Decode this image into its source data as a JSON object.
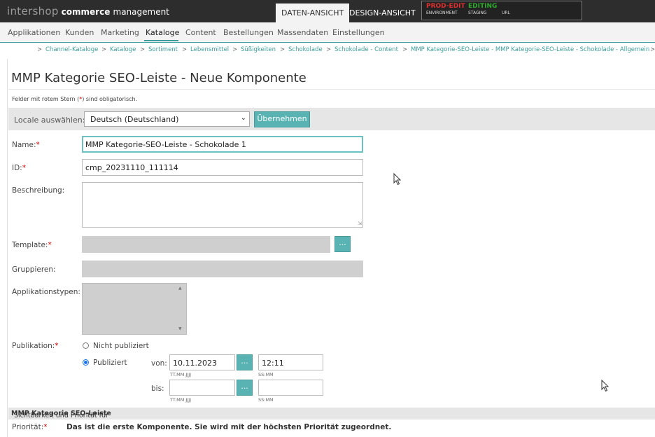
{
  "app": {
    "brand": "intershop",
    "name_bold": "commerce",
    "name_light": "management"
  },
  "view_tabs": {
    "data_view": "DATEN-ANSICHT",
    "design_view": "DESIGN-ANSICHT"
  },
  "environment": {
    "environment_value": "PROD-EDIT",
    "environment_label": "ENVIRONMENT",
    "staging_value": "EDITING",
    "staging_label": "STAGING",
    "url_label": "URL",
    "environment_color": "#e03030",
    "staging_color": "#2faa2f"
  },
  "main_nav": {
    "items": [
      "Applikationen",
      "Kunden",
      "Marketing",
      "Kataloge",
      "Content",
      "Bestellungen",
      "Massendaten",
      "Einstellungen"
    ],
    "active": "Kataloge"
  },
  "breadcrumb": {
    "separator": ">",
    "items": [
      "Channel-Kataloge",
      "Kataloge",
      "Sortiment",
      "Lebensmittel",
      "Süßigkeiten",
      "Schokolade",
      "Schokolade - Content",
      "MMP Kategorie-SEO-Leiste - MMP Kategorie-SEO-Leiste - Schokolade - Allgemein"
    ]
  },
  "page": {
    "title": "MMP Kategorie SEO-Leiste - Neue Komponente",
    "required_note_before": "Felder mit rotem Stern (",
    "required_note_star": "*",
    "required_note_after": ") sind obligatorisch."
  },
  "locale": {
    "label": "Locale auswählen:",
    "selected": "Deutsch (Deutschland)",
    "apply_button": "Übernehmen"
  },
  "form": {
    "required_marker": "*",
    "name_label": "Name:",
    "name_value": "MMP Kategorie-SEO-Leiste - Schokolade 1",
    "id_label": "ID:",
    "id_value": "cmp_20231110_111114",
    "description_label": "Beschreibung:",
    "template_label": "Template:",
    "template_button": "...",
    "group_label": "Gruppieren:",
    "app_types_label": "Applikationstypen:",
    "publication_label": "Publikation:",
    "not_published": "Nicht publiziert",
    "published": "Publiziert",
    "published_selected": true,
    "from_label": "von:",
    "from_date": "10.11.2023",
    "from_time": "12:11",
    "to_label": "bis:",
    "to_date": "",
    "to_time": "",
    "date_hint": "TT.MM.JJJJ",
    "time_hint": "SS:MM",
    "date_button": "..."
  },
  "visibility": {
    "prefix": "Sichtbarkeit und Priorität für",
    "component": "MMP Kategorie SEO-Leiste",
    "priority_label": "Priorität:",
    "priority_message": "Das ist die erste Komponente. Sie wird mit der höchsten Priorität zugeordnet."
  },
  "colors": {
    "accent": "#3d9c9c",
    "button": "#5ab3b3",
    "required": "#cc0000"
  }
}
